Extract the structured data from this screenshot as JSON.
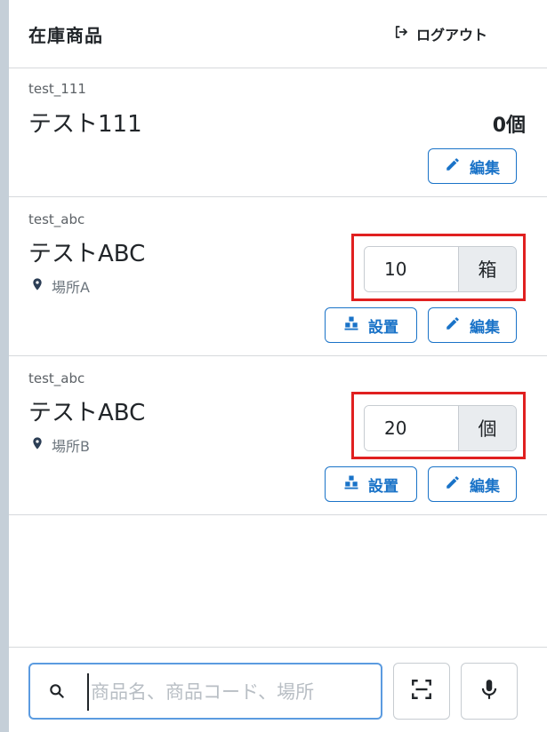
{
  "header": {
    "title": "在庫商品",
    "logout_label": "ログアウト"
  },
  "items": [
    {
      "code": "test_111",
      "name": "テスト111",
      "quantity": "0個",
      "edit_label": "編集"
    },
    {
      "code": "test_abc",
      "name": "テストABC",
      "location": "場所A",
      "quantity_value": "10",
      "unit": "箱",
      "place_label": "設置",
      "edit_label": "編集"
    },
    {
      "code": "test_abc",
      "name": "テストABC",
      "location": "場所B",
      "quantity_value": "20",
      "unit": "個",
      "place_label": "設置",
      "edit_label": "編集"
    }
  ],
  "search": {
    "placeholder": "商品名、商品コード、場所",
    "value": ""
  },
  "colors": {
    "accent": "#1a73c8",
    "highlight": "#e02020",
    "unit_bg": "#e9ecef"
  }
}
